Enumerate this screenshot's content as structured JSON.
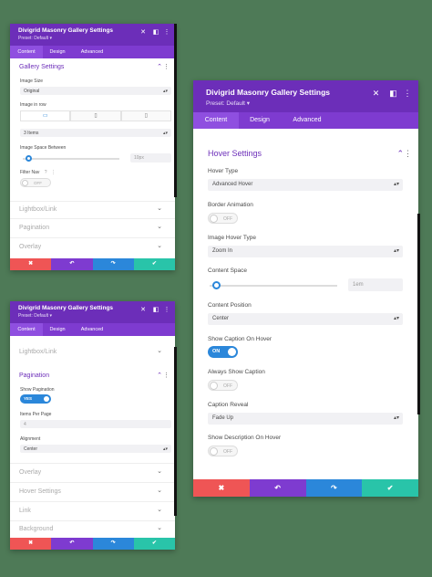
{
  "icons": {
    "close": "close-icon",
    "split": "split-view-icon",
    "more": "more-icon",
    "chevron_up": "chevron-up-icon",
    "chevron_down": "chevron-down-icon",
    "dots": "vertical-dots-icon",
    "desktop": "desktop-icon",
    "tablet": "tablet-icon",
    "phone": "phone-icon"
  },
  "colors": {
    "header": "#6c2eb9",
    "tabs": "#7e3bd0",
    "accent": "#2b87da",
    "cancel": "#ef5555",
    "undo": "#7e3bd0",
    "redo": "#2b87da",
    "save": "#29c4a9",
    "background": "#4e7a57"
  },
  "panel1": {
    "title": "Divigrid Masonry Gallery Settings",
    "preset": "Preset: Default ▾",
    "tabs": [
      "Content",
      "Design",
      "Advanced"
    ],
    "section": "Gallery Settings",
    "image_size_label": "Image Size",
    "image_size_value": "Original",
    "image_in_row_label": "Image in row",
    "image_in_row_value": "3 Items",
    "space_label": "Image Space Between",
    "space_value": "10px",
    "filter_label": "Filter Nav",
    "filter_toggle": "OFF",
    "collapsed": [
      "Lightbox/Link",
      "Pagination",
      "Overlay"
    ]
  },
  "panel2": {
    "title": "Divigrid Masonry Gallery Settings",
    "preset": "Preset: Default ▾",
    "tabs": [
      "Content",
      "Design",
      "Advanced"
    ],
    "lightbox": "Lightbox/Link",
    "section": "Pagination",
    "show_pagination_label": "Show Pagination",
    "show_pagination_toggle": "YES",
    "items_per_page_label": "Items Per Page",
    "items_per_page_value": "4",
    "alignment_label": "Alignment",
    "alignment_value": "Center",
    "collapsed": [
      "Overlay",
      "Hover Settings",
      "Link",
      "Background"
    ]
  },
  "panel3": {
    "title": "Divigrid Masonry Gallery Settings",
    "preset": "Preset: Default ▾",
    "tabs": [
      "Content",
      "Design",
      "Advanced"
    ],
    "section": "Hover Settings",
    "hover_type_label": "Hover Type",
    "hover_type_value": "Advanced Hover",
    "border_anim_label": "Border Animation",
    "border_anim_toggle": "OFF",
    "image_hover_label": "Image Hover Type",
    "image_hover_value": "Zoom In",
    "content_space_label": "Content Space",
    "content_space_value": "1em",
    "content_pos_label": "Content Position",
    "content_pos_value": "Center",
    "show_caption_label": "Show Caption On Hover",
    "show_caption_toggle": "ON",
    "always_caption_label": "Always Show Caption",
    "always_caption_toggle": "OFF",
    "caption_reveal_label": "Caption Reveal",
    "caption_reveal_value": "Fade Up",
    "show_desc_label": "Show Description On Hover",
    "show_desc_toggle": "OFF"
  },
  "footer": {
    "cancel": "✖",
    "undo": "↶",
    "redo": "↷",
    "save": "✔"
  },
  "glyphs": {
    "close": "✕",
    "split": "◧",
    "more": "⋮",
    "chev_up": "⌃",
    "chev_down": "⌄",
    "arrow": "▴▾",
    "desktop": "▭",
    "tablet": "▯",
    "phone": "▯"
  }
}
